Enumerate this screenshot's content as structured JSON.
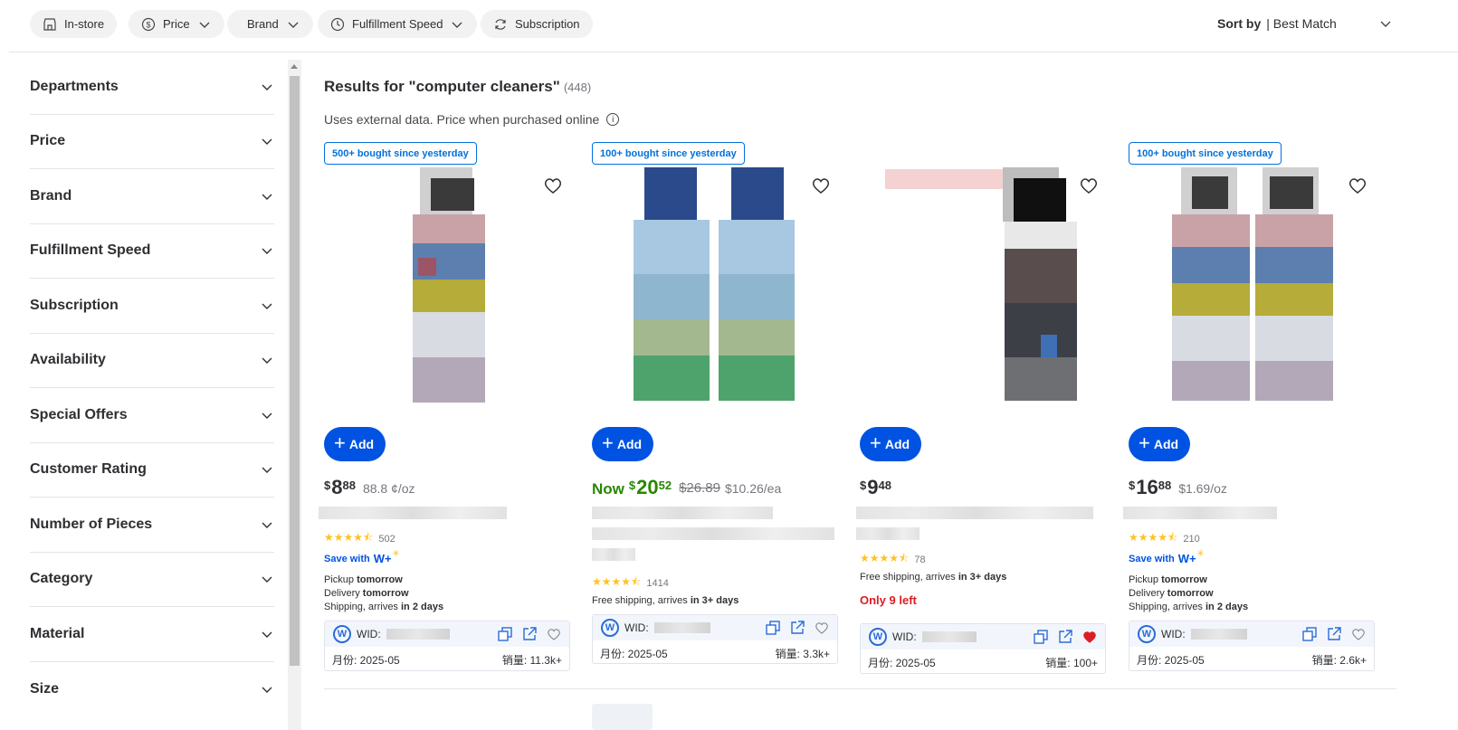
{
  "filters": {
    "chips": [
      {
        "label": "In-store",
        "icon": "store-icon"
      },
      {
        "label": "Price",
        "icon": "dollar-icon"
      },
      {
        "label": "Brand",
        "icon": ""
      },
      {
        "label": "Fulfillment Speed",
        "icon": "clock-icon"
      },
      {
        "label": "Subscription",
        "icon": "refresh-icon"
      }
    ],
    "sort_label": "Sort by",
    "sort_value": "| Best Match"
  },
  "sidebar": {
    "facets": [
      "Departments",
      "Price",
      "Brand",
      "Fulfillment Speed",
      "Subscription",
      "Availability",
      "Special Offers",
      "Customer Rating",
      "Number of Pieces",
      "Category",
      "Material",
      "Size"
    ]
  },
  "results": {
    "title": "Results for \"computer cleaners\"",
    "count": "(448)",
    "note": "Uses external data. Price when purchased online",
    "info_icon": "i"
  },
  "products": [
    {
      "badge": "500+ bought since yesterday",
      "add_label": "Add",
      "price_currency": "$",
      "price_dollars": "8",
      "price_cents": "88",
      "unit_price": "88.8 ¢/oz",
      "rating_count": "502",
      "save_with": "Save with",
      "wplus": "W+",
      "ship_l1_a": "Pickup ",
      "ship_l1_b": "tomorrow",
      "ship_l2_a": "Delivery ",
      "ship_l2_b": "tomorrow",
      "ship_l3_a": "Shipping, arrives ",
      "ship_l3_b": "in 2 days",
      "wid_label": "WID:",
      "month": "月份: 2025-05",
      "sales": "销量: 11.3k+"
    },
    {
      "badge": "100+ bought since yesterday",
      "add_label": "Add",
      "now_label": "Now",
      "price_currency": "$",
      "price_dollars": "20",
      "price_cents": "52",
      "was_price": "$26.89",
      "unit_price": "$10.26/ea",
      "rating_count": "1414",
      "ship_l1_a": "Free shipping, arrives ",
      "ship_l1_b": "in 3+ days",
      "wid_label": "WID:",
      "month": "月份: 2025-05",
      "sales": "销量: 3.3k+"
    },
    {
      "add_label": "Add",
      "price_currency": "$",
      "price_dollars": "9",
      "price_cents": "48",
      "rating_count": "78",
      "ship_l1_a": "Free shipping, arrives ",
      "ship_l1_b": "in 3+ days",
      "low_stock": "Only 9 left",
      "wid_label": "WID:",
      "month": "月份: 2025-05",
      "sales": "销量: 100+"
    },
    {
      "badge": "100+ bought since yesterday",
      "add_label": "Add",
      "price_currency": "$",
      "price_dollars": "16",
      "price_cents": "88",
      "unit_price": "$1.69/oz",
      "rating_count": "210",
      "save_with": "Save with",
      "wplus": "W+",
      "ship_l1_a": "Pickup ",
      "ship_l1_b": "tomorrow",
      "ship_l2_a": "Delivery ",
      "ship_l2_b": "tomorrow",
      "ship_l3_a": "Shipping, arrives ",
      "ship_l3_b": "in 2 days",
      "wid_label": "WID:",
      "month": "月份: 2025-05",
      "sales": "销量: 2.6k+"
    }
  ],
  "stars": "★★★★⯪",
  "colors": {
    "accent_blue": "#0053e2",
    "now_green": "#2a8703",
    "alert_red": "#de1c24",
    "star_yellow": "#ffc220"
  }
}
